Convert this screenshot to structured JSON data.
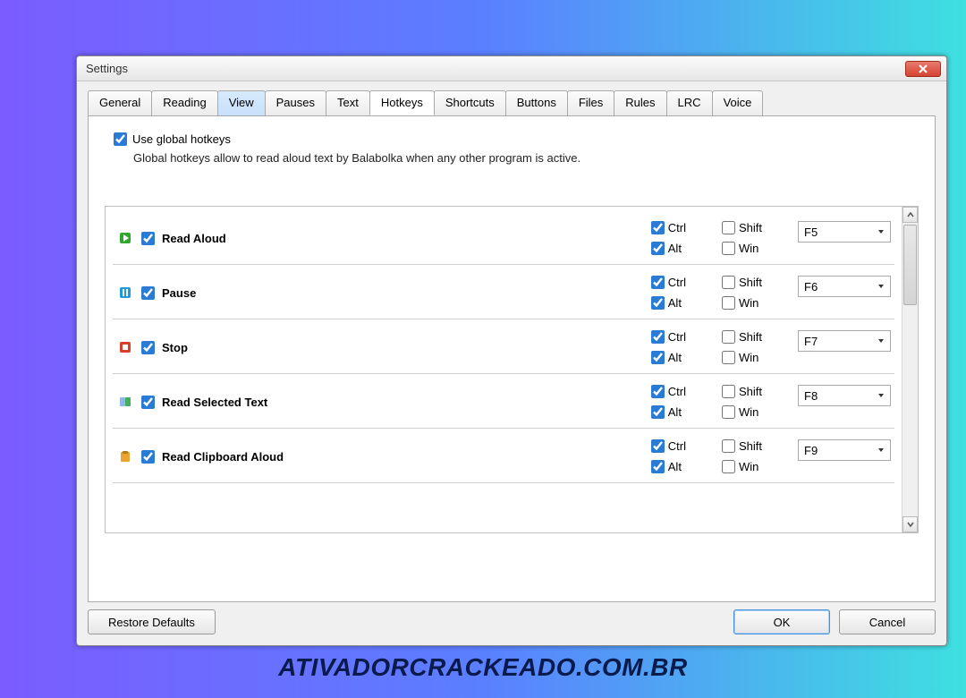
{
  "window": {
    "title": "Settings"
  },
  "tabs": [
    "General",
    "Reading",
    "View",
    "Pauses",
    "Text",
    "Hotkeys",
    "Shortcuts",
    "Buttons",
    "Files",
    "Rules",
    "LRC",
    "Voice"
  ],
  "activeTab": "Hotkeys",
  "highlightedTab": "View",
  "global": {
    "checkbox_label": "Use global hotkeys",
    "description": "Global hotkeys allow to read aloud text by Balabolka when any other program is active."
  },
  "modifierLabels": {
    "ctrl": "Ctrl",
    "alt": "Alt",
    "shift": "Shift",
    "win": "Win"
  },
  "hotkeys": [
    {
      "icon": "play",
      "iconColor": "#2da82d",
      "label": "Read Aloud",
      "enabled": true,
      "ctrl": true,
      "alt": true,
      "shift": false,
      "win": false,
      "key": "F5"
    },
    {
      "icon": "pause",
      "iconColor": "#1e9bd8",
      "label": "Pause",
      "enabled": true,
      "ctrl": true,
      "alt": true,
      "shift": false,
      "win": false,
      "key": "F6"
    },
    {
      "icon": "stop",
      "iconColor": "#d6402b",
      "label": "Stop",
      "enabled": true,
      "ctrl": true,
      "alt": true,
      "shift": false,
      "win": false,
      "key": "F7"
    },
    {
      "icon": "selected",
      "iconColor": "#41b05d",
      "label": "Read Selected Text",
      "enabled": true,
      "ctrl": true,
      "alt": true,
      "shift": false,
      "win": false,
      "key": "F8"
    },
    {
      "icon": "clipboard",
      "iconColor": "#e9a52e",
      "label": "Read Clipboard Aloud",
      "enabled": true,
      "ctrl": true,
      "alt": true,
      "shift": false,
      "win": false,
      "key": "F9"
    }
  ],
  "buttons": {
    "restore": "Restore Defaults",
    "ok": "OK",
    "cancel": "Cancel"
  },
  "watermark": "ATIVADORCRACKEADO.COM.BR"
}
